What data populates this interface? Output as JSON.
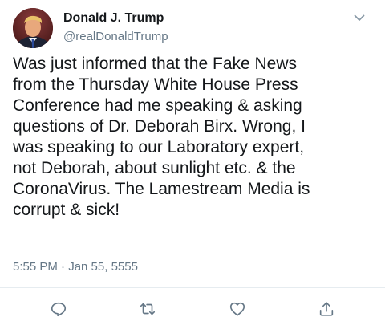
{
  "tweet": {
    "author": {
      "display_name": "Donald J. Trump",
      "handle": "@realDonaldTrump"
    },
    "lines": [
      "Was just informed that the Fake News",
      "from the Thursday White House Press",
      "Conference had me speaking & asking",
      "questions of Dr. Deborah Birx. Wrong, I",
      "was speaking to our Laboratory expert,",
      "not Deborah, about sunlight etc. & the",
      "CoronaVirus. The Lamestream Media is",
      "corrupt & sick!"
    ],
    "timestamp": "5:55 PM · Jan 55, 5555"
  },
  "icons": {
    "menu": "chevron-down-icon",
    "reply": "reply-icon",
    "retweet": "retweet-icon",
    "like": "heart-icon",
    "share": "share-icon"
  },
  "colors": {
    "text": "#14171a",
    "secondary": "#657786",
    "icon": "#657786",
    "divider": "#e6ecf0"
  }
}
